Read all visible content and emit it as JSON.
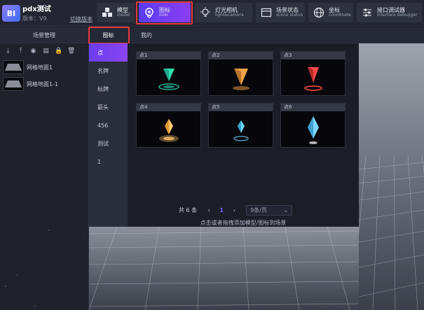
{
  "app": {
    "title": "pdx测试",
    "version": "版本：V9",
    "switch_version": "切换版本",
    "logo_text": "BI"
  },
  "toolbar": [
    {
      "id": "model",
      "cn": "模型",
      "en": "model",
      "icon": "cubes-icon"
    },
    {
      "id": "icon",
      "cn": "图标",
      "en": "icon",
      "icon": "location-target-icon",
      "active": true
    },
    {
      "id": "light",
      "cn": "灯光相机",
      "en": "light&camera",
      "icon": "bulb-icon"
    },
    {
      "id": "scene",
      "cn": "场景状态",
      "en": "scene status",
      "icon": "window-icon"
    },
    {
      "id": "coord",
      "cn": "坐标",
      "en": "coordinate",
      "icon": "globe-icon"
    },
    {
      "id": "debug",
      "cn": "接口调试器",
      "en": "interface debugger",
      "icon": "sliders-icon"
    }
  ],
  "left_panel": {
    "title": "场景管理",
    "tool_icons": [
      "download-icon",
      "upload-icon",
      "target-icon",
      "copy-icon",
      "lock-icon",
      "delete-icon"
    ],
    "tool_glyphs": [
      "⤓",
      "⤒",
      "◉",
      "▤",
      "🔒",
      "🗑"
    ],
    "items": [
      "网格地面1",
      "网格地面1-1"
    ]
  },
  "tabs": [
    "图标",
    "我的"
  ],
  "categories": [
    "点",
    "名牌",
    "标牌",
    "箭头",
    "456",
    "测试",
    "1"
  ],
  "icons": [
    {
      "label": "点1",
      "color": "#2ee0b0"
    },
    {
      "label": "点2",
      "color": "#f0a24a"
    },
    {
      "label": "点3",
      "color": "#ff4a4a"
    },
    {
      "label": "点4",
      "color": "#ffc66b"
    },
    {
      "label": "点5",
      "color": "#6fd8ff"
    },
    {
      "label": "点6",
      "color": "#7ad8ff"
    }
  ],
  "pagination": {
    "total": "共 6 条",
    "prev": "‹",
    "current": "1",
    "next": "›",
    "page_size": "9条/页",
    "dropdown": "⌄"
  },
  "hint": "点击或者拖拽添加模型/图标到场景",
  "colors": {
    "accent": "#7b3ff2",
    "highlight_box": "#e33b3b",
    "page_active": "#6e63ff"
  }
}
